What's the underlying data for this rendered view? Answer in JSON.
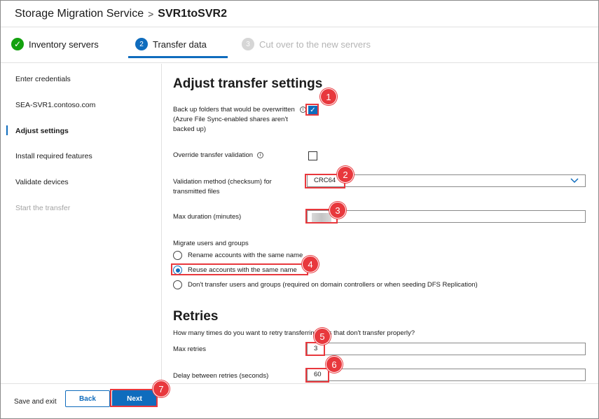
{
  "header": {
    "app_title": "Storage Migration Service",
    "separator": ">",
    "job_name": "SVR1toSVR2"
  },
  "stepper": {
    "steps": [
      {
        "label": "Inventory servers",
        "state": "done",
        "icon": "check-icon"
      },
      {
        "label": "Transfer data",
        "state": "current",
        "number": "2"
      },
      {
        "label": "Cut over to the new servers",
        "state": "disabled",
        "number": "3"
      }
    ]
  },
  "sidebar": {
    "items": [
      {
        "label": "Enter credentials",
        "state": "normal"
      },
      {
        "label": "SEA-SVR1.contoso.com",
        "state": "normal"
      },
      {
        "label": "Adjust settings",
        "state": "active"
      },
      {
        "label": "Install required features",
        "state": "normal"
      },
      {
        "label": "Validate devices",
        "state": "normal"
      },
      {
        "label": "Start the transfer",
        "state": "disabled"
      }
    ]
  },
  "main": {
    "title": "Adjust transfer settings",
    "backup": {
      "label": "Back up folders that would be overwritten (Azure File Sync-enabled shares aren't backed up)",
      "checked": true
    },
    "override": {
      "label": "Override transfer validation",
      "checked": false
    },
    "validation": {
      "label": "Validation method (checksum) for transmitted files",
      "value": "CRC64"
    },
    "max_duration": {
      "label": "Max duration (minutes)",
      "value": ""
    },
    "migrate": {
      "label": "Migrate users and groups",
      "options": [
        {
          "label": "Rename accounts with the same name",
          "selected": false
        },
        {
          "label": "Reuse accounts with the same name",
          "selected": true
        },
        {
          "label": "Don't transfer users and groups (required on domain controllers or when seeding DFS Replication)",
          "selected": false
        }
      ]
    },
    "retries": {
      "title": "Retries",
      "description": "How many times do you want to retry transferring files that don't transfer properly?",
      "max_label": "Max retries",
      "max_value": "3",
      "delay_label": "Delay between retries (seconds)",
      "delay_value": "60"
    }
  },
  "footer": {
    "save_exit": "Save and exit",
    "back": "Back",
    "next": "Next"
  },
  "callouts": [
    "1",
    "2",
    "3",
    "4",
    "5",
    "6",
    "7"
  ],
  "colors": {
    "accent": "#0f6cbd",
    "success": "#13a10e",
    "callout": "#e8383d"
  }
}
